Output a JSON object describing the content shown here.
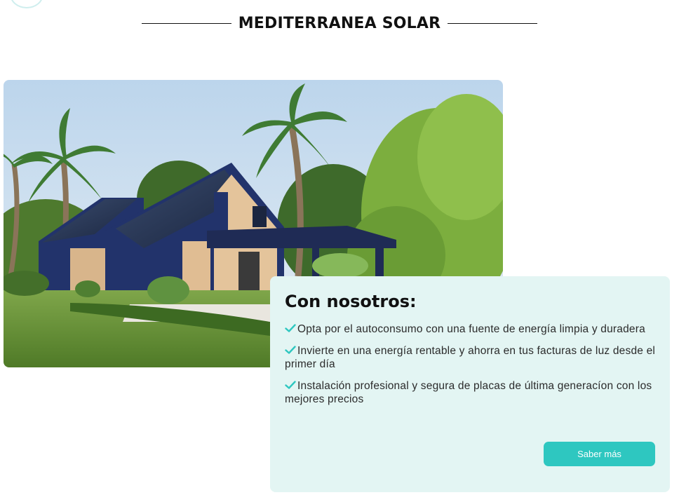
{
  "header": {
    "title": "MEDITERRANEA SOLAR"
  },
  "hero": {
    "image_alt": "Modern house with solar panels on the roof surrounded by palm trees and a garden"
  },
  "card": {
    "title": "Con nosotros:",
    "items": [
      {
        "text": "Opta por el autoconsumo con una fuente de energía limpia y duradera",
        "icon": "check-icon"
      },
      {
        "text": "Invierte en una energía rentable y ahorra en tus facturas de luz desde el primer día",
        "icon": "check-icon"
      },
      {
        "text": "Instalación profesional y segura de placas de última generacíon con los mejores precios",
        "icon": "check-icon"
      }
    ],
    "button_label": "Saber más"
  },
  "colors": {
    "accent": "#2ec7c0",
    "card_background": "#e3f5f3",
    "check": "#2ec7c0",
    "title": "#111111"
  }
}
